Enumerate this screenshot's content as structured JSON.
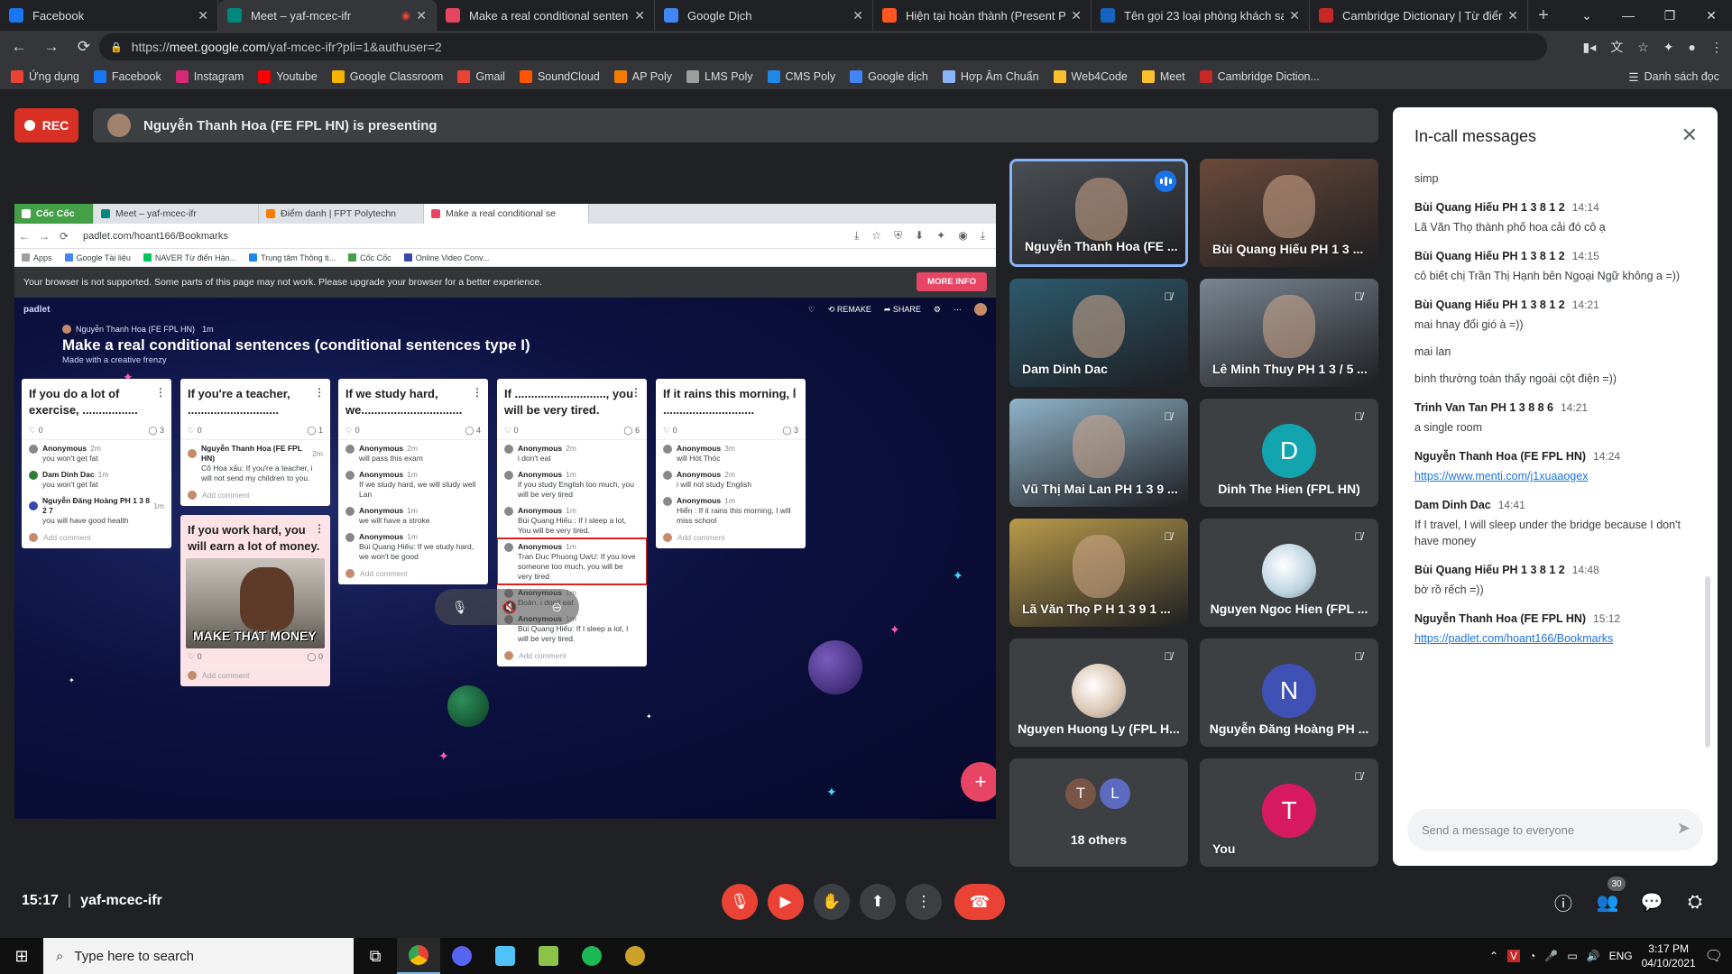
{
  "tabs": [
    {
      "label": "Facebook",
      "color": "#1877f2",
      "icon": "facebook-icon"
    },
    {
      "label": "Meet – yaf-mcec-ifr",
      "color": "#00897b",
      "icon": "meet-icon",
      "active": true,
      "recording": true
    },
    {
      "label": "Make a real conditional sentenc",
      "color": "#e84565",
      "icon": "padlet-icon"
    },
    {
      "label": "Google Dịch",
      "color": "#4285f4",
      "icon": "google-translate-icon"
    },
    {
      "label": "Hiện tại hoàn thành (Present Pe",
      "color": "#ff5722",
      "icon": "site-icon"
    },
    {
      "label": "Tên gọi 23 loại phòng khách sạn",
      "color": "#1565c0",
      "icon": "site-icon"
    },
    {
      "label": "Cambridge Dictionary | Từ điển",
      "color": "#c62828",
      "icon": "cambridge-icon"
    }
  ],
  "url": {
    "scheme": "https://",
    "host": "meet.google.com",
    "path": "/yaf-mcec-ifr?pli=1&authuser=2"
  },
  "bookmarks": [
    {
      "label": "Ứng dụng",
      "color": "#ea4335"
    },
    {
      "label": "Facebook",
      "color": "#1877f2"
    },
    {
      "label": "Instagram",
      "color": "#d62976"
    },
    {
      "label": "Youtube",
      "color": "#ff0000"
    },
    {
      "label": "Google Classroom",
      "color": "#f4b400"
    },
    {
      "label": "Gmail",
      "color": "#ea4335"
    },
    {
      "label": "SoundCloud",
      "color": "#ff5500"
    },
    {
      "label": "AP Poly",
      "color": "#f57c00"
    },
    {
      "label": "LMS Poly",
      "color": "#9e9e9e"
    },
    {
      "label": "CMS Poly",
      "color": "#1e88e5"
    },
    {
      "label": "Google dịch",
      "color": "#4285f4"
    },
    {
      "label": "Hợp Âm Chuẩn",
      "color": "#8ab4f8"
    },
    {
      "label": "Web4Code",
      "color": "#fbc02d"
    },
    {
      "label": "Meet",
      "color": "#fbc02d"
    },
    {
      "label": "Cambridge Diction...",
      "color": "#c62828"
    }
  ],
  "bookmarks_right": "Danh sách đọc",
  "rec_label": "REC",
  "presenting_text": "Nguyễn Thanh Hoa (FE FPL HN) is presenting",
  "shared": {
    "tabs": [
      {
        "label": "Cốc Cốc",
        "color": "#43a047"
      },
      {
        "label": "Meet – yaf-mcec-ifr",
        "color": "#00897b"
      },
      {
        "label": "Điểm danh | FPT Polytechn",
        "color": "#f57c00"
      },
      {
        "label": "Make a real conditional se",
        "color": "#e84565"
      }
    ],
    "url": "padlet.com/hoant166/Bookmarks",
    "bookmarks": [
      {
        "label": "Apps",
        "color": "#9e9e9e"
      },
      {
        "label": "Google Tài liệu",
        "color": "#4285f4"
      },
      {
        "label": "NAVER Từ điển Hàn...",
        "color": "#03c75a"
      },
      {
        "label": "Trung tâm Thông ti...",
        "color": "#1e88e5"
      },
      {
        "label": "Cốc Cốc",
        "color": "#43a047"
      },
      {
        "label": "Online Video Conv...",
        "color": "#3949ab"
      }
    ],
    "warning": "Your browser is not supported. Some parts of this page may not work. Please upgrade your browser for a better experience.",
    "more_info": "MORE INFO",
    "padlet": {
      "logo": "padlet",
      "author": "Nguyễn Thanh Hoa (FE FPL HN)",
      "author_time": "1m",
      "title": "Make a real conditional sentences (conditional sentences type I)",
      "subtitle": "Made with a creative frenzy",
      "remake": "REMAKE",
      "share": "SHARE",
      "add_comment": "Add comment",
      "cards": [
        {
          "title": "If you do a lot of exercise, .................",
          "likes": "0",
          "comments": "3",
          "items": [
            {
              "name": "Anonymous",
              "time": "2m",
              "text": "you won't get fat",
              "avatar": "#888888"
            },
            {
              "name": "Dam Dinh Dac",
              "time": "1m",
              "text": "you won't get fat",
              "avatar": "#2e7d32"
            },
            {
              "name": "Nguyễn Đăng Hoàng PH 1 3 8 2 7",
              "time": "1m",
              "text": "you will have good health",
              "avatar": "#3949ab"
            }
          ]
        },
        {
          "title": "If you're a teacher, ............................",
          "likes": "0",
          "comments": "1",
          "items": [
            {
              "name": "Nguyễn Thanh Hoa (FE FPL HN)",
              "time": "2m",
              "text": "Cô Hoa xấu: If you're a teacher, i will not send my children to you.",
              "avatar": "#c58b6a"
            }
          ]
        },
        {
          "title": "If you work hard, you will earn a lot of money.",
          "image_caption": "MAKE THAT MONEY",
          "likes": "0",
          "comments": "0",
          "items": []
        },
        {
          "title": "If we study hard, we...............................",
          "likes": "0",
          "comments": "4",
          "items": [
            {
              "name": "Anonymous",
              "time": "2m",
              "text": "will pass this exam",
              "avatar": "#888888"
            },
            {
              "name": "Anonymous",
              "time": "1m",
              "text": "If we study hard, we will study well Lan",
              "avatar": "#888888"
            },
            {
              "name": "Anonymous",
              "time": "1m",
              "text": "we will have a stroke",
              "avatar": "#888888"
            },
            {
              "name": "Anonymous",
              "time": "1m",
              "text": "Bùi Quang Hiếu: If we study hard, we won't be good",
              "avatar": "#888888"
            }
          ]
        },
        {
          "title": "If ............................, you will be very tired.",
          "likes": "0",
          "comments": "6",
          "items": [
            {
              "name": "Anonymous",
              "time": "2m",
              "text": "i don't eat",
              "avatar": "#888888"
            },
            {
              "name": "Anonymous",
              "time": "1m",
              "text": "if you study English too much, you will be very tired",
              "avatar": "#888888"
            },
            {
              "name": "Anonymous",
              "time": "1m",
              "text": "Bùi Quang Hiếu : If I sleep a lot, You will be very tired.",
              "avatar": "#888888"
            },
            {
              "name": "Anonymous",
              "time": "1m",
              "text": "Tran Duc Phuong UwU: If you love someone too much, you will be very tired",
              "avatar": "#888888",
              "highlight": true
            },
            {
              "name": "Anonymous",
              "time": "1m",
              "text": "Đoàn. i don't eat",
              "avatar": "#888888"
            },
            {
              "name": "Anonymous",
              "time": "1m",
              "text": "Bùi Quang Hiếu: If I sleep a lot, I will be very tired.",
              "avatar": "#888888"
            }
          ]
        },
        {
          "title": "If it rains this morning, I ............................",
          "likes": "0",
          "comments": "3",
          "items": [
            {
              "name": "Anonymous",
              "time": "3m",
              "text": "will Hót Thóc",
              "avatar": "#888888"
            },
            {
              "name": "Anonymous",
              "time": "2m",
              "text": "i will not study English",
              "avatar": "#888888"
            },
            {
              "name": "Anonymous",
              "time": "1m",
              "text": "Hiển : If it rains this morning, I will miss school",
              "avatar": "#888888"
            }
          ]
        }
      ]
    }
  },
  "participants": [
    {
      "name": "Nguyễn Thanh Hoa (FE ...",
      "kind": "video",
      "bg": "#4a4f55",
      "speaking": true
    },
    {
      "name": "Bùi Quang Hiếu PH 1 3 ...",
      "kind": "video",
      "bg": "#6b4a3a"
    },
    {
      "name": "Dam Dinh Dac",
      "kind": "video",
      "bg": "#2d5a6e",
      "muted": true
    },
    {
      "name": "Lê Minh Thuy PH 1 3 / 5 ...",
      "kind": "video",
      "bg": "#7a8591",
      "muted": true
    },
    {
      "name": "Vũ Thị Mai Lan PH 1 3 9 ...",
      "kind": "video",
      "bg": "#8fb3c9",
      "muted": true
    },
    {
      "name": "Dinh The Hien (FPL HN)",
      "kind": "avatar",
      "letter": "D",
      "color": "#12a4af",
      "muted": true
    },
    {
      "name": "Lã Văn Thọ P H 1 3 9 1 ...",
      "kind": "video",
      "bg": "#b89a4a",
      "muted": true
    },
    {
      "name": "Nguyen Ngoc Hien (FPL ...",
      "kind": "photo",
      "color": "#bcd4e0",
      "muted": true
    },
    {
      "name": "Nguyen Huong Ly (FPL H...",
      "kind": "photo",
      "color": "#d9c4b0",
      "muted": true
    },
    {
      "name": "Nguyễn Đăng Hoàng PH ...",
      "kind": "avatar",
      "letter": "N",
      "color": "#3f51b5",
      "muted": true
    },
    {
      "name": "18 others",
      "kind": "others",
      "letters": [
        "T",
        "L"
      ],
      "colors": [
        "#795548",
        "#5c6bc0"
      ]
    },
    {
      "name": "You",
      "kind": "avatar",
      "letter": "T",
      "color": "#d81b60",
      "muted": true
    }
  ],
  "chat": {
    "title": "In-call messages",
    "placeholder": "Send a message to everyone",
    "messages": [
      {
        "lines": [
          "simp"
        ]
      },
      {
        "sender": "Bùi Quang Hiếu PH 1 3 8 1 2",
        "time": "14:14",
        "lines": [
          "Lã Văn Thọ thành phố hoa cải đó cô ạ"
        ]
      },
      {
        "sender": "Bùi Quang Hiếu PH 1 3 8 1 2",
        "time": "14:15",
        "lines": [
          "cô biết chị Trần Thị Hạnh bên Ngoại Ngữ không a =))"
        ]
      },
      {
        "sender": "Bùi Quang Hiếu PH 1 3 8 1 2",
        "time": "14:21",
        "lines": [
          "mai hnay đổi gió à =))",
          "mai lan",
          "bình thường toàn thấy ngoài cột điện =))"
        ]
      },
      {
        "sender": "Trinh Van Tan PH 1 3 8 8 6",
        "time": "14:21",
        "lines": [
          "a single room"
        ]
      },
      {
        "sender": "Nguyễn Thanh Hoa (FE FPL HN)",
        "time": "14:24",
        "link": "https://www.menti.com/j1xuaaogex"
      },
      {
        "sender": "Dam Dinh Dac",
        "time": "14:41",
        "lines": [
          "If I travel, I will sleep under the bridge because I don't have money"
        ]
      },
      {
        "sender": "Bùi Quang Hiếu PH 1 3 8 1 2",
        "time": "14:48",
        "lines": [
          "bờ rồ rếch =))"
        ]
      },
      {
        "sender": "Nguyễn Thanh Hoa (FE FPL HN)",
        "time": "15:12",
        "link": "https://padlet.com/hoant166/Bookmarks"
      }
    ]
  },
  "bottom": {
    "time": "15:17",
    "code": "yaf-mcec-ifr",
    "participant_count": "30"
  },
  "taskbar": {
    "search_placeholder": "Type here to search",
    "lang": "ENG",
    "time": "3:17 PM",
    "date": "04/10/2021"
  }
}
